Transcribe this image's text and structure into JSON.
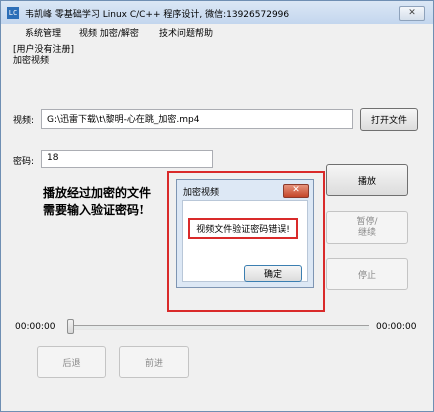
{
  "window": {
    "title": "韦凯峰 零基础学习 Linux C/C++ 程序设计, 微信:13926572996",
    "app_icon": "LC",
    "close_icon": "✕"
  },
  "menu": {
    "items": [
      "系统管理",
      "视频 加密/解密",
      "技术问题帮助"
    ]
  },
  "status": {
    "line1": "[用户没有注册]",
    "line2": "加密视频"
  },
  "video": {
    "label": "视频:",
    "path": "G:\\迅雷下载\\t\\黎明-心在跳_加密.mp4",
    "open_button": "打开文件"
  },
  "password": {
    "label": "密码:",
    "value": "18"
  },
  "controls": {
    "play": "播放",
    "pause_line1": "暂停/",
    "pause_line2": "继续",
    "stop": "停止",
    "back": "后退",
    "forward": "前进"
  },
  "progress": {
    "current_time": "00:00:00",
    "total_time": "00:00:00",
    "position": 0
  },
  "annotation": {
    "line1": "播放经过加密的文件",
    "line2": "需要输入验证密码!"
  },
  "dialog": {
    "title": "加密视频",
    "message": "视频文件验证密码错误!",
    "ok_button": "确定",
    "close_icon": "✕"
  },
  "colors": {
    "highlight_red": "#d92a2a",
    "title_blue": "#c3d6ee"
  }
}
